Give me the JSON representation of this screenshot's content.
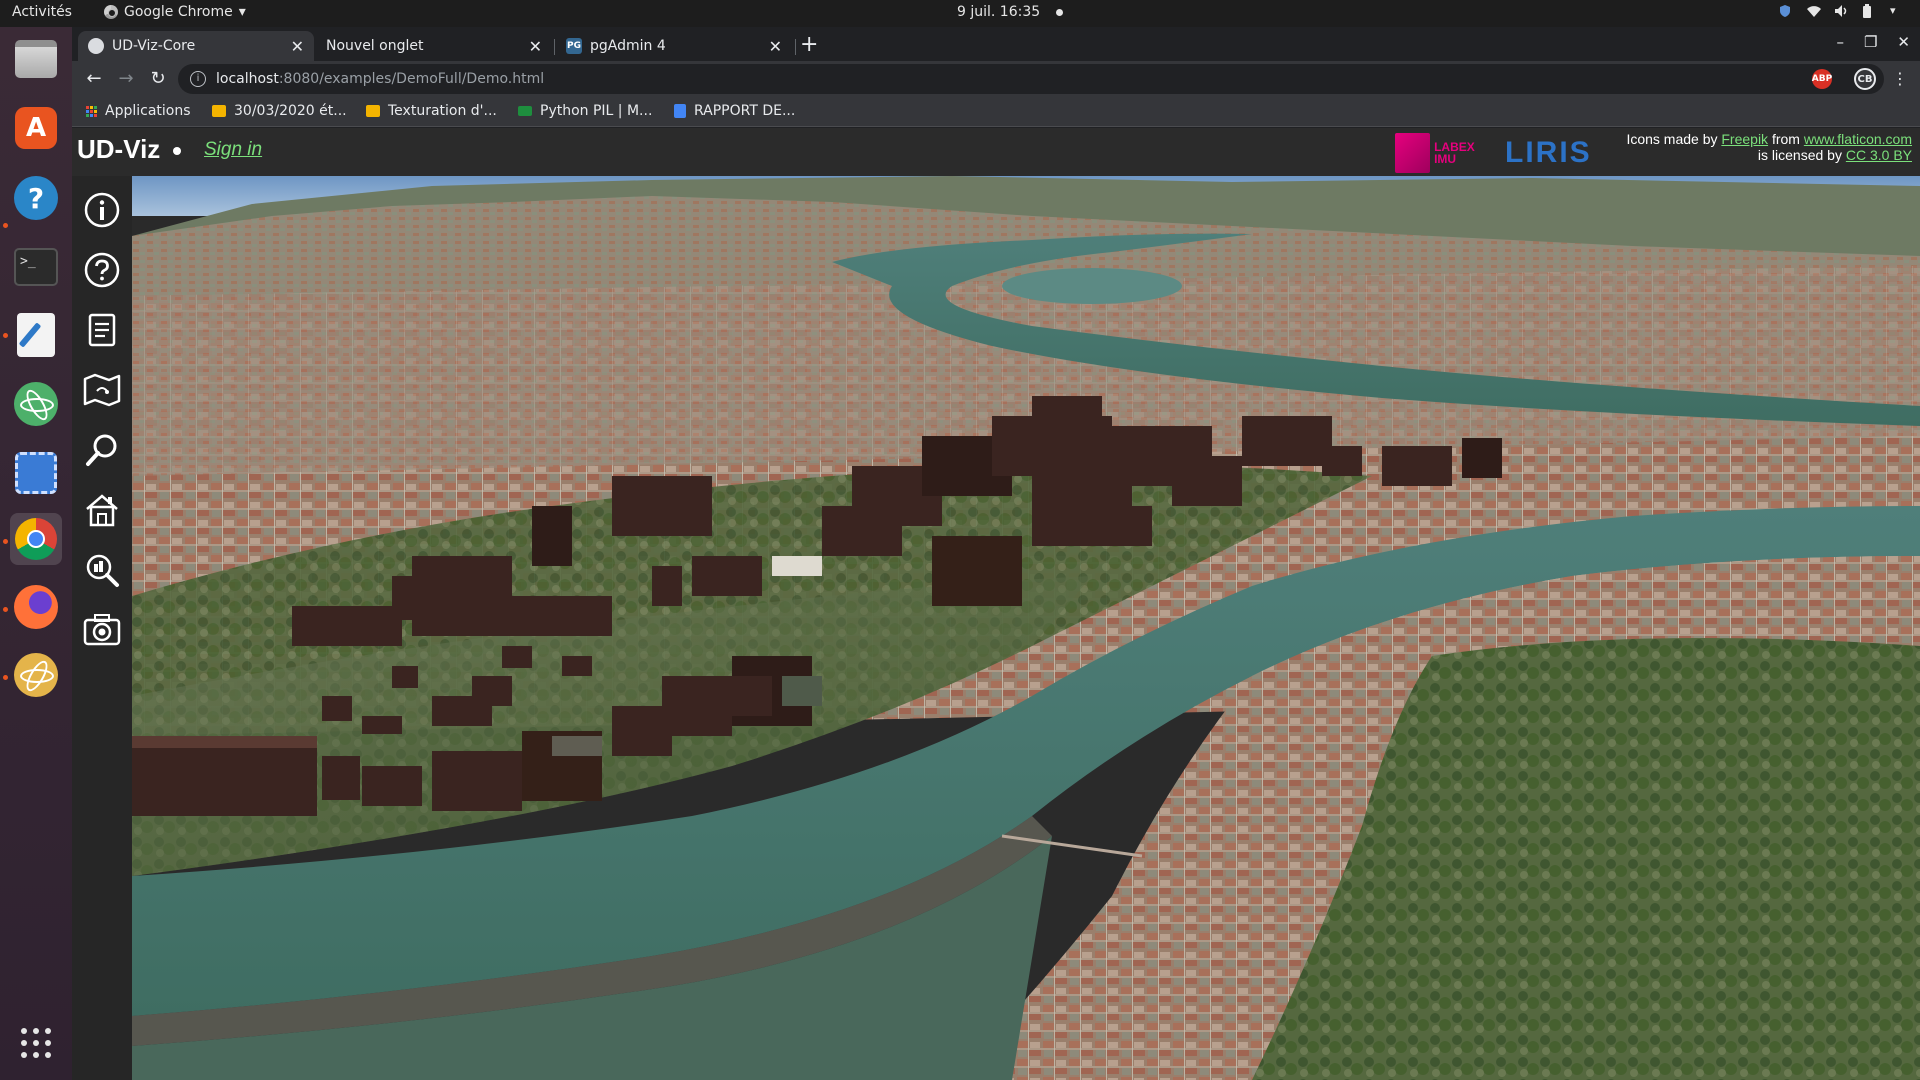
{
  "gnome": {
    "activities": "Activités",
    "app_menu": "Google Chrome",
    "app_menu_arrow": "▾",
    "clock": "9 juil.  16:35"
  },
  "dock": {
    "apps": [
      {
        "name": "Files"
      },
      {
        "name": "Ubuntu Software"
      },
      {
        "name": "Help"
      },
      {
        "name": "Terminal"
      },
      {
        "name": "Text Editor"
      },
      {
        "name": "Atom"
      },
      {
        "name": "Screenshot"
      },
      {
        "name": "Google Chrome"
      },
      {
        "name": "Firefox"
      },
      {
        "name": "Atom"
      }
    ]
  },
  "browser": {
    "tabs": [
      {
        "title": "UD-Viz-Core",
        "active": true
      },
      {
        "title": "Nouvel onglet",
        "active": false
      },
      {
        "title": "pgAdmin 4",
        "active": false
      }
    ],
    "new_tab": "+",
    "url_host": "localhost",
    "url_path": ":8080/examples/DemoFull/Demo.html",
    "ext_abp": "ABP",
    "profile": "CB",
    "bookmarks": [
      {
        "label": "Applications",
        "color": "#e8eaed"
      },
      {
        "label": "30/03/2020 ét...",
        "color": "#f4b400"
      },
      {
        "label": "Texturation d'...",
        "color": "#f4b400"
      },
      {
        "label": "Python PIL | M...",
        "color": "#1e8e3e"
      },
      {
        "label": "RAPPORT DE...",
        "color": "#4285f4"
      }
    ]
  },
  "page": {
    "title": "UD-Viz",
    "sign_in": "Sign in",
    "labex_text": "LABEX IMU",
    "liris_text": "LIRIS",
    "credits": {
      "line1_prefix": "Icons made by ",
      "line1_link1": "Freepik",
      "line1_mid": " from ",
      "line1_link2": "www.flaticon.com",
      "line2_prefix": "is licensed by ",
      "line2_link": "CC 3.0 BY"
    },
    "sidebar_buttons": [
      {
        "icon": "info-icon"
      },
      {
        "icon": "help-icon"
      },
      {
        "icon": "document-icon"
      },
      {
        "icon": "map-icon"
      },
      {
        "icon": "search-icon"
      },
      {
        "icon": "home-icon"
      },
      {
        "icon": "city-search-icon"
      },
      {
        "icon": "camera-icon"
      }
    ]
  },
  "colors": {
    "accent_link": "#7be07b",
    "river": "#4d8177",
    "roof": "#9c6a55",
    "building": "#3a2420",
    "vegetation": "#4f6a3c"
  }
}
